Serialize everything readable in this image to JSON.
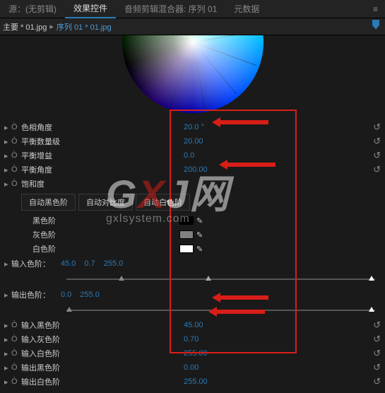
{
  "tabs": {
    "source": "源：(无剪辑)",
    "effect_controls": "效果控件",
    "audio_mixer": "音频剪辑混合器: 序列 01",
    "metadata": "元数据"
  },
  "breadcrumb": {
    "main": "主要 * 01.jpg",
    "path": "序列 01 * 01.jpg"
  },
  "params": {
    "hue_angle": {
      "label": "色相角度",
      "value": "20.0 °"
    },
    "balance_mag": {
      "label": "平衡数量级",
      "value": "20.00"
    },
    "balance_gain": {
      "label": "平衡增益",
      "value": "0.0"
    },
    "balance_angle": {
      "label": "平衡角度",
      "value": "200.00"
    },
    "saturation": {
      "label": "饱和度",
      "value": ""
    }
  },
  "buttons": {
    "auto_black": "自动黑色阶",
    "auto_contrast": "自动对比度",
    "auto_white": "自动白色阶"
  },
  "swatches": {
    "black": {
      "label": "黑色阶",
      "color": "#000000"
    },
    "gray": {
      "label": "灰色阶",
      "color": "#808080"
    },
    "white": {
      "label": "白色阶",
      "color": "#ffffff"
    }
  },
  "input_levels": {
    "label": "输入色阶：",
    "v1": "45.0",
    "v2": "0.7",
    "v3": "255.0"
  },
  "output_levels": {
    "label": "输出色阶：",
    "v1": "0.0",
    "v2": "255.0"
  },
  "inputs": {
    "black": {
      "label": "输入黑色阶",
      "value": "45.00"
    },
    "gray": {
      "label": "输入灰色阶",
      "value": "0.70"
    },
    "white": {
      "label": "输入白色阶",
      "value": "255.00"
    },
    "out_black": {
      "label": "输出黑色阶",
      "value": "0.00"
    },
    "out_white": {
      "label": "输出白色阶",
      "value": "255.00"
    }
  },
  "icons": {
    "expand": "▸",
    "stopwatch": "Ò",
    "reset": "↺",
    "eyedrop": "✎",
    "menu": "≡",
    "chev": "▸"
  }
}
